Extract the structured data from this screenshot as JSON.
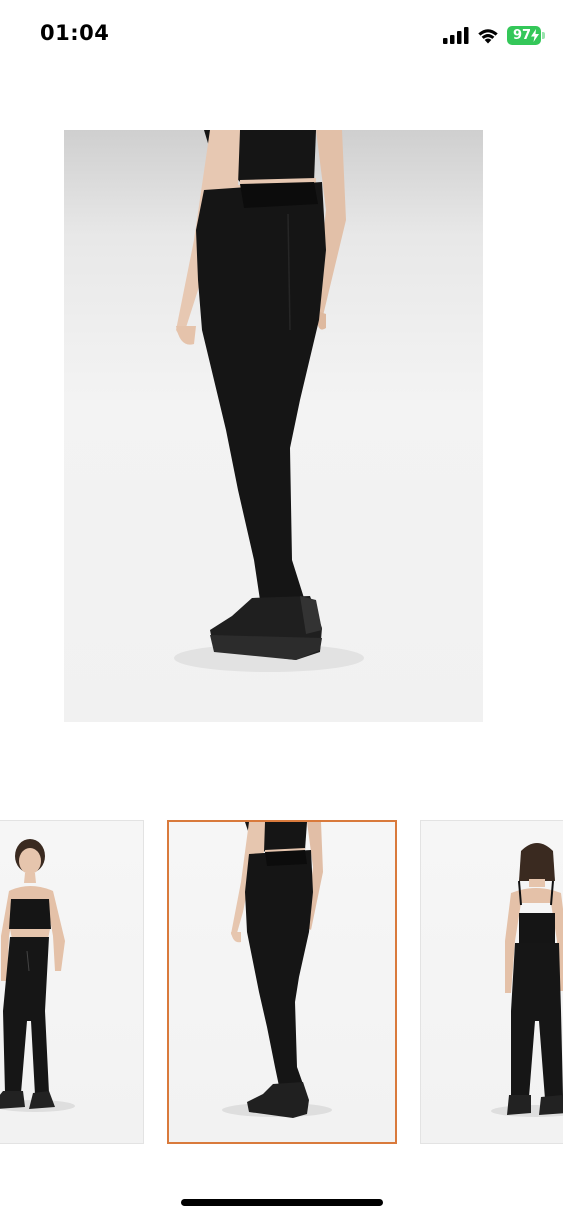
{
  "status_bar": {
    "time": "01:04",
    "battery": "97",
    "icons": [
      "cellular-signal-icon",
      "wifi-icon",
      "battery-icon",
      "charging-bolt-icon"
    ]
  },
  "gallery": {
    "selected_index": 1,
    "thumbnail_count": 3,
    "selection_color": "#d97a3c"
  },
  "colors": {
    "background": "#ffffff",
    "battery": "#34c759",
    "garment": "#151515"
  }
}
